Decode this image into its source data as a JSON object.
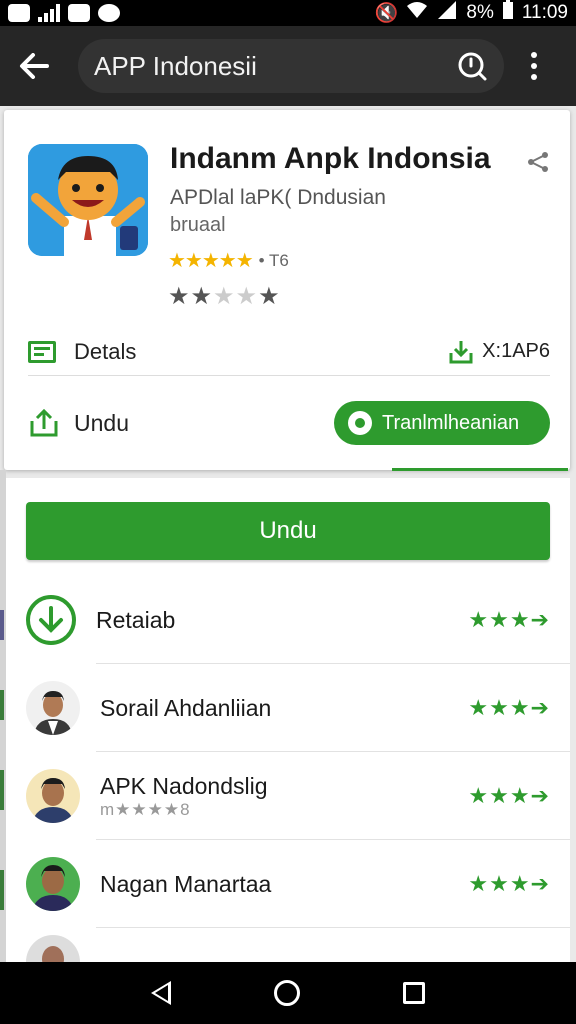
{
  "status_bar": {
    "battery": "8%",
    "time": "11:09"
  },
  "search": {
    "query": "APP Indonesii"
  },
  "app": {
    "title": "Indanm Anpk Indonsia",
    "subtitle": "APDlal laPK( Dndusian",
    "developer": "bruaal",
    "rating_stars": "★★★★★",
    "rating_count": "• T6",
    "secondary_rating": 2,
    "details_label": "Detals",
    "size_label": "X:1AP6",
    "undu_label": "Undu",
    "install_label": "Tranlmlheanian"
  },
  "main_button": "Undu",
  "list": [
    {
      "name": "Retaiab",
      "sub": "",
      "stars": "★★★➔",
      "type": "download"
    },
    {
      "name": "Sorail Ahdanliian",
      "sub": "",
      "stars": "★★★➔",
      "type": "person"
    },
    {
      "name": "APK Nadondslig",
      "sub": "m★★★★8",
      "stars": "★★★➔",
      "type": "person"
    },
    {
      "name": "Nagan Manartaa",
      "sub": "",
      "stars": "★★★➔",
      "type": "person"
    }
  ],
  "colors": {
    "accent": "#2e9b2e",
    "star_gold": "#f4b400",
    "appbar": "#262626"
  }
}
